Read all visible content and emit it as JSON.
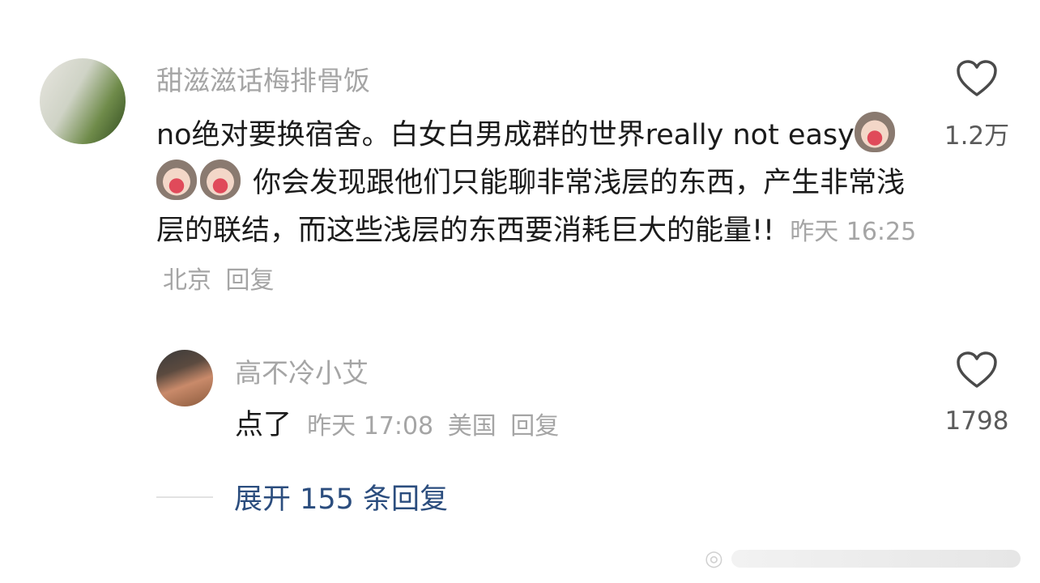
{
  "comment": {
    "username": "甜滋滋话梅排骨饭",
    "text": "no绝对要换宿舍。白女白男成群的世界really not easy",
    "text_after_emoji": " 你会发现跟他们只能聊非常浅层的东西，产生非常浅层的联结，而这些浅层的东西要消耗巨大的能量!!",
    "emoji_icon": "crying-cat-emoji",
    "emoji_count": 3,
    "meta": {
      "time": "昨天 16:25",
      "location": "北京",
      "reply_label": "回复"
    },
    "likes": "1.2万"
  },
  "reply": {
    "username": "高不冷小艾",
    "text": "点了",
    "meta": {
      "time": "昨天 17:08",
      "location": "美国",
      "reply_label": "回复"
    },
    "likes": "1798"
  },
  "expand": {
    "label": "展开 155 条回复"
  },
  "colors": {
    "username": "#a5a5a5",
    "body_text": "#1b1b1b",
    "link": "#2b4d7e"
  }
}
